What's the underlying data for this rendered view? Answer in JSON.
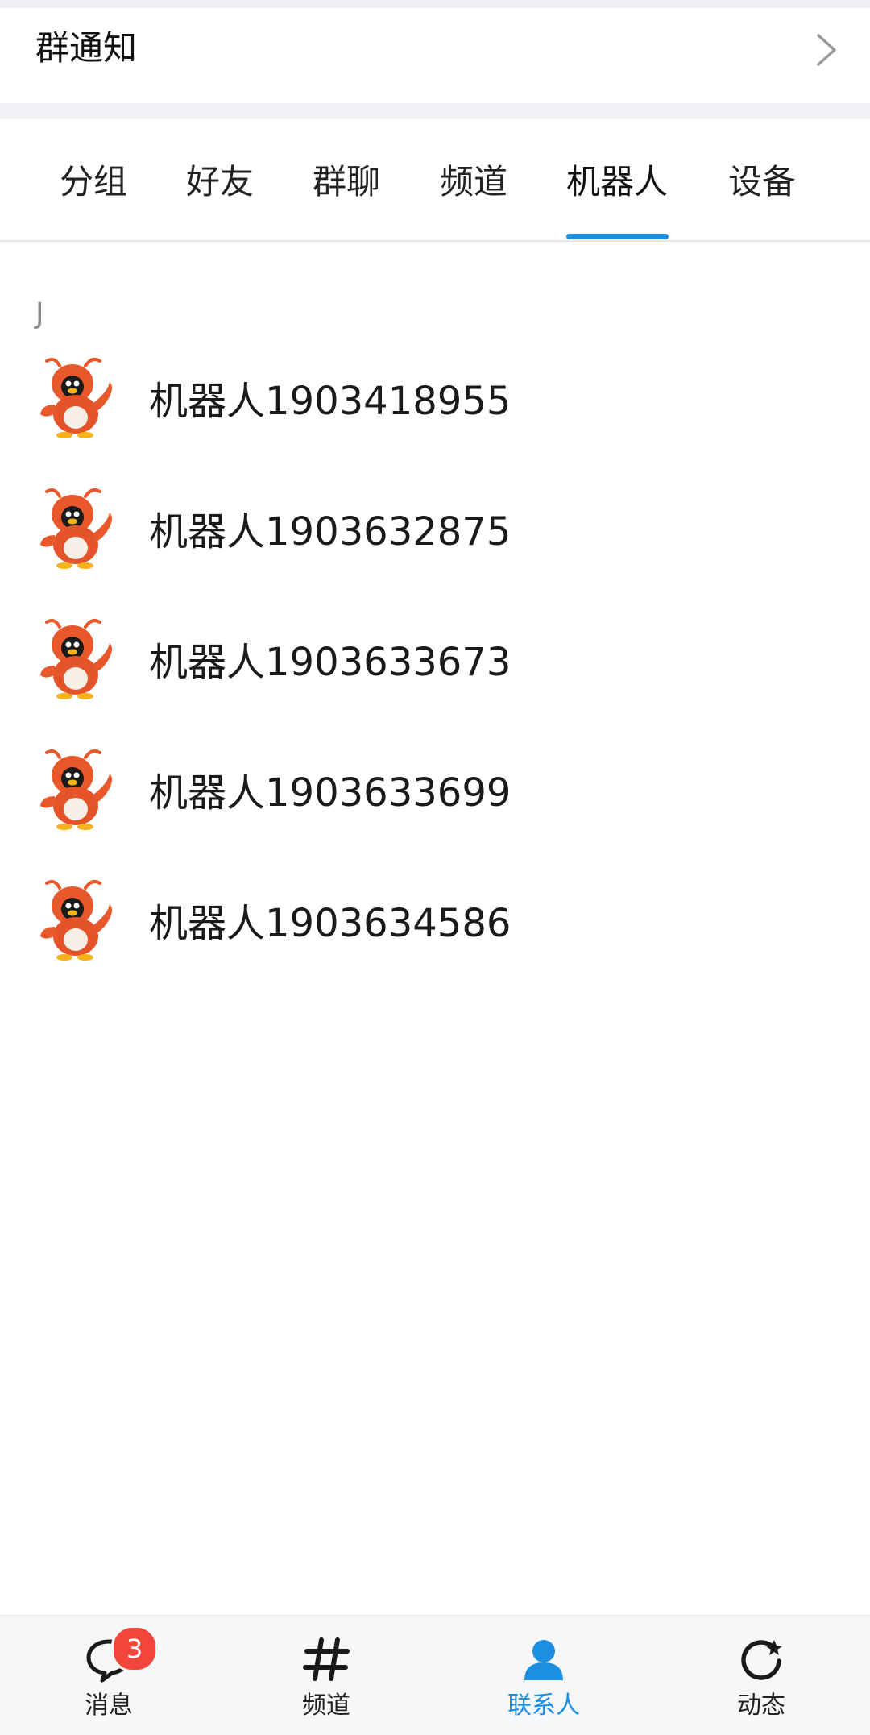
{
  "header": {
    "notice_label": "群通知"
  },
  "tabs": [
    {
      "label": "分组",
      "active": false
    },
    {
      "label": "好友",
      "active": false
    },
    {
      "label": "群聊",
      "active": false
    },
    {
      "label": "频道",
      "active": false
    },
    {
      "label": "机器人",
      "active": true
    },
    {
      "label": "设备",
      "active": false
    }
  ],
  "section": {
    "letter": "J"
  },
  "contacts": [
    {
      "name": "机器人1903418955",
      "avatar_icon": "robot-lobster-penguin-avatar"
    },
    {
      "name": "机器人1903632875",
      "avatar_icon": "robot-lobster-penguin-avatar"
    },
    {
      "name": "机器人1903633673",
      "avatar_icon": "robot-lobster-penguin-avatar"
    },
    {
      "name": "机器人1903633699",
      "avatar_icon": "robot-lobster-penguin-avatar"
    },
    {
      "name": "机器人1903634586",
      "avatar_icon": "robot-lobster-penguin-avatar"
    }
  ],
  "bottom_nav": {
    "items": [
      {
        "label": "消息",
        "icon": "chat-bubble-icon",
        "badge": "3",
        "active": false
      },
      {
        "label": "频道",
        "icon": "hashtag-icon",
        "active": false
      },
      {
        "label": "联系人",
        "icon": "person-icon",
        "active": true
      },
      {
        "label": "动态",
        "icon": "refresh-star-icon",
        "active": false
      }
    ]
  },
  "colors": {
    "accent": "#1c8fe3",
    "badge": "#f2463c",
    "avatar_orange": "#e8582a"
  }
}
